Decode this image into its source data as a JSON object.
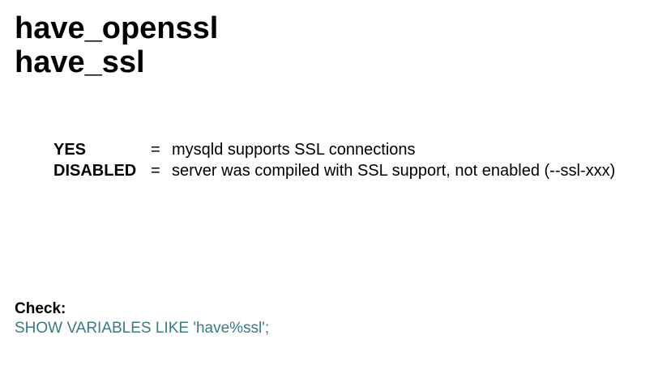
{
  "title": {
    "line1": "have_openssl",
    "line2": "have_ssl"
  },
  "definitions": [
    {
      "term": "YES",
      "equals": "=",
      "description": "mysqld supports SSL connections"
    },
    {
      "term": "DISABLED",
      "equals": "=",
      "description": "server was compiled with SSL support, not enabled (--ssl-xxx)"
    }
  ],
  "check": {
    "label": "Check:",
    "query": "SHOW VARIABLES LIKE 'have%ssl';"
  },
  "colors": {
    "text": "#000000",
    "query": "#3a7a84",
    "background": "#ffffff"
  }
}
